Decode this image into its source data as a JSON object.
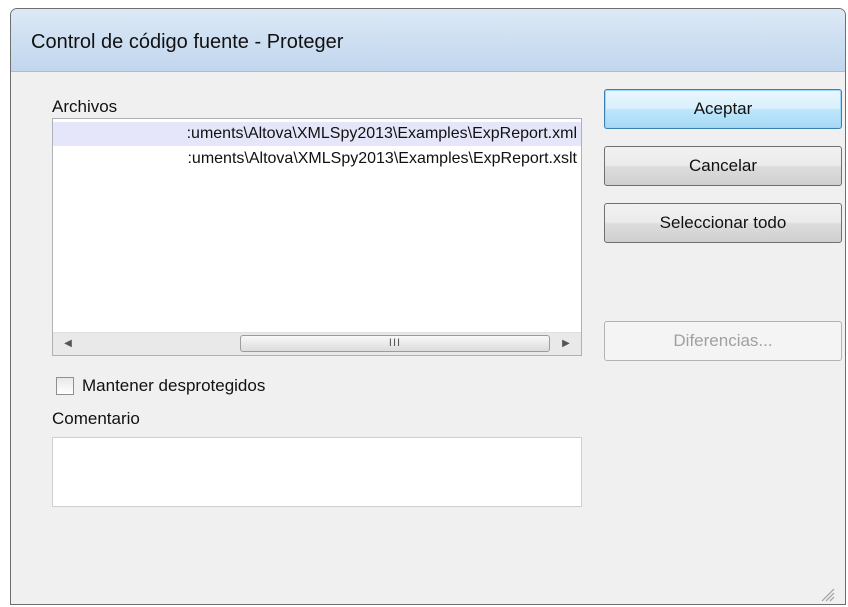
{
  "window": {
    "title": "Control de código fuente - Proteger"
  },
  "files": {
    "label": "Archivos",
    "items": [
      {
        "text": ":uments\\Altova\\XMLSpy2013\\Examples\\ExpReport.xml",
        "selected": true
      },
      {
        "text": ":uments\\Altova\\XMLSpy2013\\Examples\\ExpReport.xslt",
        "selected": false
      }
    ],
    "scrollbar_grip": "III"
  },
  "keep_checked_out": {
    "label": "Mantener desprotegidos",
    "checked": false
  },
  "comment": {
    "label": "Comentario",
    "value": ""
  },
  "buttons": {
    "ok": "Aceptar",
    "cancel": "Cancelar",
    "select_all": "Seleccionar todo",
    "differences": "Diferencias..."
  },
  "colors": {
    "title_bar": "#cfe0f2",
    "selected_row": "#e6e6fa",
    "default_button_border": "#3c7fb1"
  }
}
